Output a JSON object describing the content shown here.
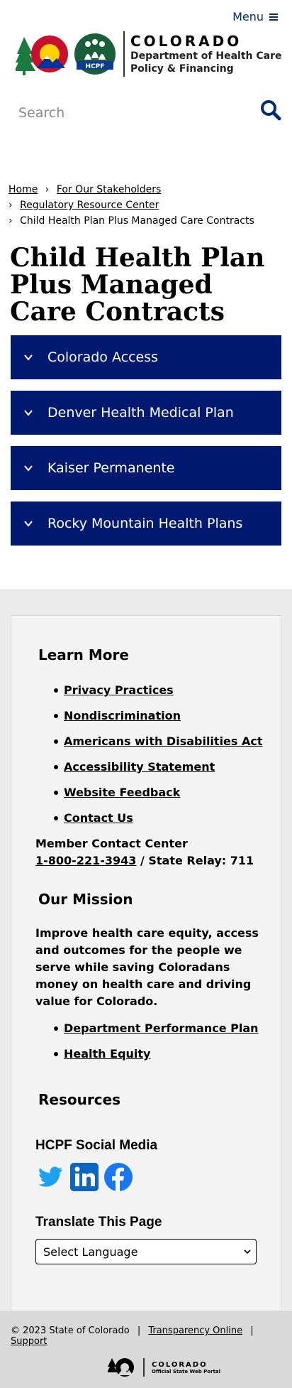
{
  "header": {
    "menu_label": "Menu",
    "state_name": "COLORADO",
    "department_line1": "Department of Health Care",
    "department_line2": "Policy & Financing",
    "hcpf_logo_text": "HCPF"
  },
  "search": {
    "placeholder": "Search"
  },
  "breadcrumb": {
    "home": "Home",
    "stakeholders": "For Our Stakeholders",
    "resource_center": "Regulatory Resource Center",
    "current": "Child Health Plan Plus Managed Care Contracts",
    "separator": "›"
  },
  "page": {
    "title": "Child Health Plan Plus Managed Care Contracts"
  },
  "accordions": [
    {
      "label": "Colorado Access"
    },
    {
      "label": "Denver Health Medical Plan"
    },
    {
      "label": "Kaiser Permanente"
    },
    {
      "label": "Rocky Mountain Health Plans"
    }
  ],
  "footer": {
    "learn_more_heading": "Learn More",
    "learn_more_links": [
      "Privacy Practices",
      "Nondiscrimination",
      "Americans with Disabilities Act",
      "Accessibility Statement",
      "Website Feedback",
      "Contact Us"
    ],
    "contact_label": "Member Contact Center",
    "contact_phone": "1-800-221-3943",
    "relay": " / State Relay: 711",
    "mission_heading": "Our Mission",
    "mission_text": "Improve health care equity, access and outcomes for the people we serve while saving Coloradans money on health care and driving value for Colorado.",
    "mission_links": [
      "Department Performance Plan",
      "Health Equity"
    ],
    "resources_heading": "Resources",
    "social_heading": "HCPF Social Media",
    "translate_heading": "Translate This Page",
    "language_selected": "Select Language"
  },
  "bottom": {
    "copyright": "© 2023 State of Colorado",
    "transparency": "Transparency Online",
    "support": "Support",
    "pipe": "|",
    "portal_state": "COLORADO",
    "portal_sub": "Official State Web Portal"
  },
  "colors": {
    "navy": "#001970",
    "menu_blue": "#002d72",
    "twitter": "#1da1f2",
    "linkedin": "#0a66c2",
    "facebook": "#1877f2",
    "hcpf_green": "#1b5e3a"
  }
}
